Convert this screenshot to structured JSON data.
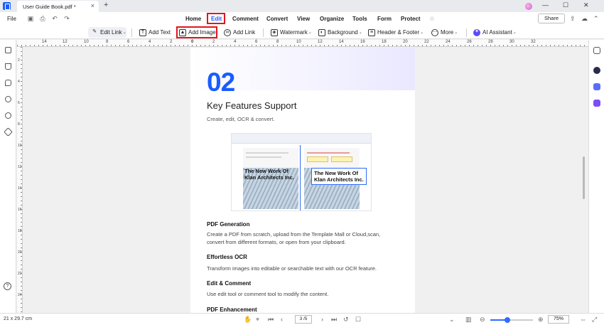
{
  "titlebar": {
    "tab_label": "User Guide Book.pdf *",
    "tab_close": "×",
    "new_tab": "+",
    "minimize": "—",
    "maximize": "☐",
    "close": "✕"
  },
  "menubar": {
    "file": "File",
    "items": [
      "Home",
      "Edit",
      "Comment",
      "Convert",
      "View",
      "Organize",
      "Tools",
      "Form",
      "Protect"
    ],
    "active": "Edit",
    "share": "Share",
    "colors": {
      "accent": "#1a5cff",
      "highlight": "#e0161e"
    }
  },
  "toolbar": {
    "edit_link": "Edit Link",
    "add_text": "Add Text",
    "add_image": "Add Image",
    "add_link": "Add Link",
    "watermark": "Watermark",
    "background": "Background",
    "header_footer": "Header & Footer",
    "more": "More",
    "ai_assistant": "AI Assistant"
  },
  "ruler": {
    "h_labels": [
      "14",
      "12",
      "10",
      "8",
      "6",
      "4",
      "2",
      "0",
      "2",
      "4",
      "6",
      "8",
      "10",
      "12",
      "14",
      "16",
      "18",
      "20",
      "22",
      "24",
      "26",
      "28",
      "30",
      "32"
    ],
    "v_labels": [
      "2",
      "4",
      "6",
      "8",
      "10",
      "12",
      "14",
      "16",
      "18",
      "20",
      "22",
      "24"
    ]
  },
  "page": {
    "number": "02",
    "title": "Key Features Support",
    "subtitle": "Create, edit, OCR & convert.",
    "screenshot_text_left": "The New Work Of\nKlan Architects Inc.",
    "screenshot_text_right": "The New Work Of\nKlan Architects Inc.",
    "sections": [
      {
        "title": "PDF Generation",
        "text": "Create a PDF from scratch, upload from the Template Mall or Cloud,scan, convert from different formats, or open from your clipboard."
      },
      {
        "title": "Effortless OCR",
        "text": "Transform images into editable or searchable text with our OCR feature."
      },
      {
        "title": "Edit & Comment",
        "text": "Use edit tool or comment tool to modify the content."
      },
      {
        "title": "PDF Enhancement",
        "text": ""
      }
    ]
  },
  "statusbar": {
    "page_size": "21 x 29.7 cm",
    "page_indicator": "3 /5",
    "zoom": "75%",
    "zoom_level": 0.4
  }
}
